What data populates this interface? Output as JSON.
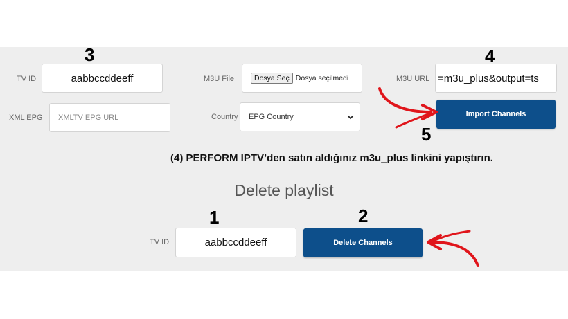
{
  "form": {
    "tv_id": {
      "label": "TV ID",
      "value": "aabbccddeeff"
    },
    "m3u_file": {
      "label": "M3U File",
      "button_label": "Dosya Seç",
      "status": "Dosya seçilmedi"
    },
    "m3u_url": {
      "label": "M3U URL",
      "value": "=m3u_plus&output=ts"
    },
    "xml_epg": {
      "label": "XML EPG",
      "placeholder": "XMLTV EPG URL"
    },
    "country": {
      "label": "Country",
      "selected": "EPG Country"
    },
    "import_button": "Import Channels"
  },
  "instruction": "(4) PERFORM IPTV’den satın aldığınız m3u_plus linkini yapıştırın.",
  "delete_section": {
    "heading": "Delete playlist",
    "tv_id_label": "TV ID",
    "tv_id_value": "aabbccddeeff",
    "delete_button": "Delete Channels"
  },
  "steps": {
    "s1": "1",
    "s2": "2",
    "s3": "3",
    "s4": "4",
    "s5": "5"
  },
  "colors": {
    "button": "#0d4f8b",
    "arrow": "#e0151b",
    "panel": "#eeeeee"
  },
  "icons": [
    "chevron-down-icon",
    "red-arrow-icon"
  ]
}
